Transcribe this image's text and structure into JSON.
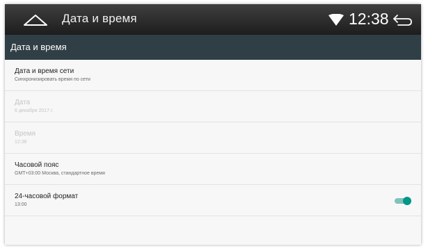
{
  "statusbar": {
    "title": "Дата и время",
    "time": "12:38",
    "home_icon": "home-outline-icon",
    "wifi_icon": "wifi-icon",
    "back_icon": "back-arrow-icon"
  },
  "appbar": {
    "title": "Дата и время"
  },
  "settings": [
    {
      "title": "Дата и время сети",
      "subtitle": "Синхронизировать время по сети",
      "enabled": true
    },
    {
      "title": "Дата",
      "subtitle": "6 декабря 2017 г.",
      "enabled": false
    },
    {
      "title": "Время",
      "subtitle": "12:38",
      "enabled": false
    },
    {
      "title": "Часовой пояс",
      "subtitle": "GMT+03:00 Москва, стандартное время",
      "enabled": true
    },
    {
      "title": "24-часовой формат",
      "subtitle": "13:00",
      "enabled": true,
      "toggle_on": true
    }
  ],
  "colors": {
    "appbar": "#303f46",
    "accent": "#009688"
  }
}
